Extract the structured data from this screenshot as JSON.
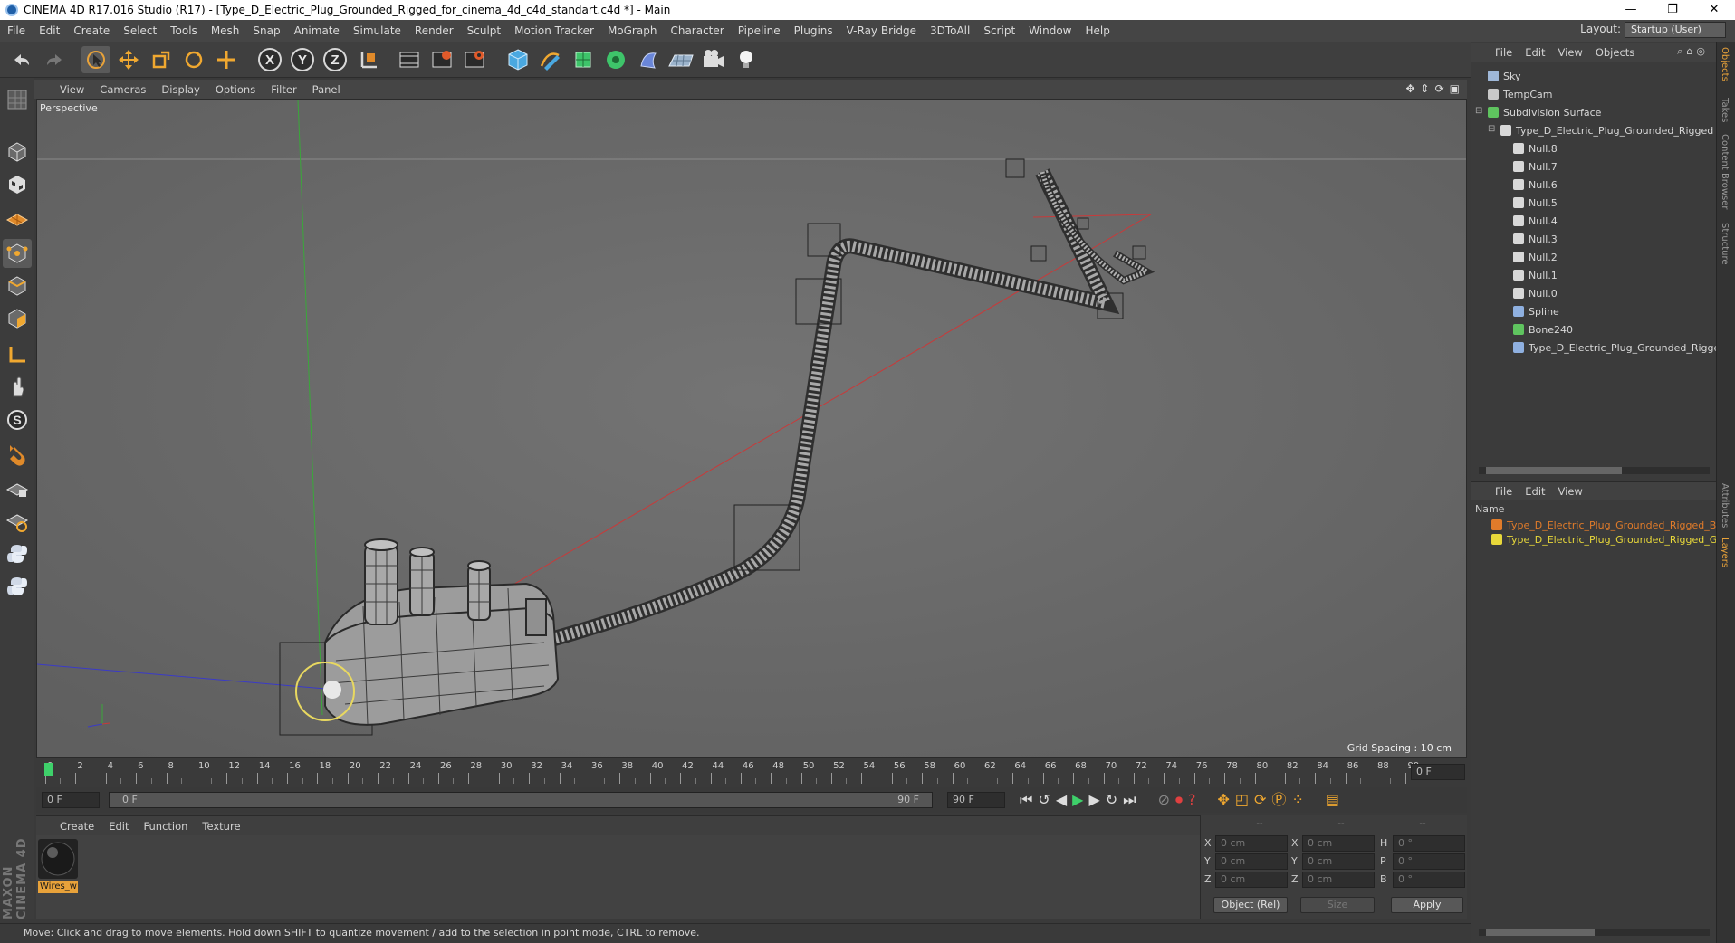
{
  "window": {
    "title": "CINEMA 4D R17.016 Studio (R17) - [Type_D_Electric_Plug_Grounded_Rigged_for_cinema_4d_c4d_standart.c4d *] - Main",
    "minimize": "—",
    "maximize": "❐",
    "close": "✕"
  },
  "menubar": {
    "items": [
      "File",
      "Edit",
      "Create",
      "Select",
      "Tools",
      "Mesh",
      "Snap",
      "Animate",
      "Simulate",
      "Render",
      "Sculpt",
      "Motion Tracker",
      "MoGraph",
      "Character",
      "Pipeline",
      "Plugins",
      "V-Ray Bridge",
      "3DToAll",
      "Script",
      "Window",
      "Help"
    ],
    "layout_label": "Layout:",
    "layout_value": "Startup (User)"
  },
  "toolbar": {
    "axis_x": "X",
    "axis_y": "Y",
    "axis_z": "Z"
  },
  "viewport": {
    "menu": [
      "View",
      "Cameras",
      "Display",
      "Options",
      "Filter",
      "Panel"
    ],
    "label": "Perspective",
    "grid_spacing": "Grid Spacing : 10 cm"
  },
  "timeline": {
    "ticks": [
      "0",
      "2",
      "4",
      "6",
      "8",
      "10",
      "12",
      "14",
      "16",
      "18",
      "20",
      "22",
      "24",
      "26",
      "28",
      "30",
      "32",
      "34",
      "36",
      "38",
      "40",
      "42",
      "44",
      "46",
      "48",
      "50",
      "52",
      "54",
      "56",
      "58",
      "60",
      "62",
      "64",
      "66",
      "68",
      "70",
      "72",
      "74",
      "76",
      "78",
      "80",
      "82",
      "84",
      "86",
      "88",
      "90"
    ],
    "current_frame": "0 F",
    "start_frame": "0 F",
    "range_start": "0 F",
    "range_end": "90 F",
    "end_frame": "90 F"
  },
  "material": {
    "menu": [
      "Create",
      "Edit",
      "Function",
      "Texture"
    ],
    "name": "Wires_w"
  },
  "coords": {
    "header": [
      "--",
      "--",
      "--"
    ],
    "rows": [
      {
        "a": "X",
        "v1": "0 cm",
        "b": "X",
        "v2": "0 cm",
        "c": "H",
        "v3": "0 °"
      },
      {
        "a": "Y",
        "v1": "0 cm",
        "b": "Y",
        "v2": "0 cm",
        "c": "P",
        "v3": "0 °"
      },
      {
        "a": "Z",
        "v1": "0 cm",
        "b": "Z",
        "v2": "0 cm",
        "c": "B",
        "v3": "0 °"
      }
    ],
    "mode": "Object (Rel)",
    "size": "Size",
    "apply": "Apply"
  },
  "objects": {
    "menu": [
      "File",
      "Edit",
      "View",
      "Objects"
    ],
    "items": [
      {
        "label": "Sky",
        "indent": 0,
        "color": "#9fb8d8"
      },
      {
        "label": "TempCam",
        "indent": 0,
        "color": "#c8c8c8"
      },
      {
        "label": "Subdivision Surface",
        "indent": 0,
        "color": "#5fc45f"
      },
      {
        "label": "Type_D_Electric_Plug_Grounded_Rigged",
        "indent": 1,
        "color": "#d8d8d8"
      },
      {
        "label": "Null.8",
        "indent": 2,
        "color": "#d8d8d8"
      },
      {
        "label": "Null.7",
        "indent": 2,
        "color": "#d8d8d8"
      },
      {
        "label": "Null.6",
        "indent": 2,
        "color": "#d8d8d8"
      },
      {
        "label": "Null.5",
        "indent": 2,
        "color": "#d8d8d8"
      },
      {
        "label": "Null.4",
        "indent": 2,
        "color": "#d8d8d8"
      },
      {
        "label": "Null.3",
        "indent": 2,
        "color": "#d8d8d8"
      },
      {
        "label": "Null.2",
        "indent": 2,
        "color": "#d8d8d8"
      },
      {
        "label": "Null.1",
        "indent": 2,
        "color": "#d8d8d8"
      },
      {
        "label": "Null.0",
        "indent": 2,
        "color": "#d8d8d8"
      },
      {
        "label": "Spline",
        "indent": 2,
        "color": "#8fb0e0"
      },
      {
        "label": "Bone240",
        "indent": 2,
        "color": "#5fc45f"
      },
      {
        "label": "Type_D_Electric_Plug_Grounded_Rigged",
        "indent": 2,
        "color": "#8fb0e0"
      }
    ]
  },
  "layers": {
    "menu": [
      "File",
      "Edit",
      "View"
    ],
    "header": "Name",
    "items": [
      {
        "label": "Type_D_Electric_Plug_Grounded_Rigged_Bon",
        "color": "#e07b2a"
      },
      {
        "label": "Type_D_Electric_Plug_Grounded_Rigged_Geo",
        "color": "#e8d83a"
      }
    ]
  },
  "sidetabs": [
    "Objects",
    "Takes",
    "Content Browser",
    "Structure",
    "Attributes",
    "Layers"
  ],
  "status": "Move: Click and drag to move elements. Hold down SHIFT to quantize movement / add to the selection in point mode, CTRL to remove.",
  "brand": "MAXON CINEMA 4D"
}
